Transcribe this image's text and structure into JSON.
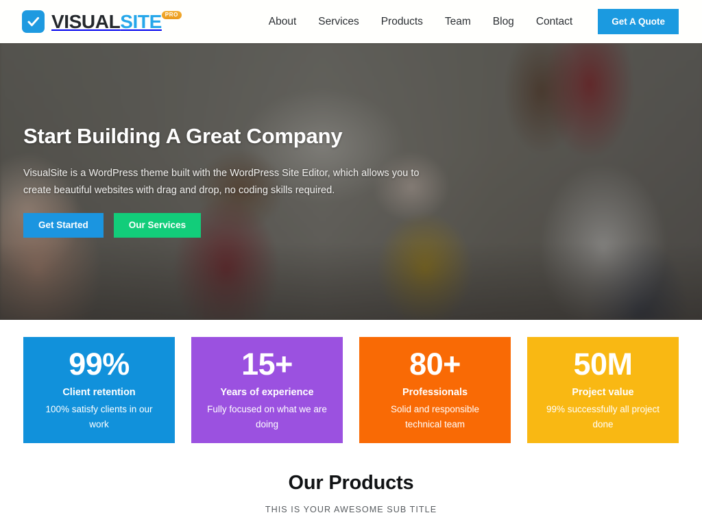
{
  "header": {
    "logo": {
      "mark_icon": "checkbox-check-icon",
      "word_primary": "VISUAL",
      "word_accent": "SITE",
      "badge": "PRO",
      "mark_color": "#1e9ae0",
      "primary_color": "#24282c",
      "accent_color": "#26a7ea",
      "badge_color": "#f0a22a"
    },
    "nav": [
      {
        "label": "About"
      },
      {
        "label": "Services"
      },
      {
        "label": "Products"
      },
      {
        "label": "Team"
      },
      {
        "label": "Blog"
      },
      {
        "label": "Contact"
      }
    ],
    "cta": {
      "label": "Get A Quote",
      "color": "#1b9ae0"
    }
  },
  "hero": {
    "title": "Start Building A Great Company",
    "description": "VisualSite is a WordPress theme built with the WordPress Site Editor, which allows you to create beautiful websites with drag and drop, no coding skills required.",
    "buttons": [
      {
        "label": "Get Started",
        "color": "#1b95e0"
      },
      {
        "label": "Our Services",
        "color": "#12cd7a"
      }
    ]
  },
  "stats": [
    {
      "value": "99%",
      "label": "Client retention",
      "description": "100% satisfy clients in our work",
      "color": "#1191db"
    },
    {
      "value": "15+",
      "label": "Years of experience",
      "description": "Fully focused on what we are doing",
      "color": "#9b51e0"
    },
    {
      "value": "80+",
      "label": "Professionals",
      "description": "Solid and responsible technical team",
      "color": "#f96a05"
    },
    {
      "value": "50M",
      "label": "Project value",
      "description": "99% successfully all project done",
      "color": "#f9b813"
    }
  ],
  "products": {
    "title": "Our Products",
    "subtitle": "THIS IS YOUR AWESOME SUB TITLE"
  }
}
